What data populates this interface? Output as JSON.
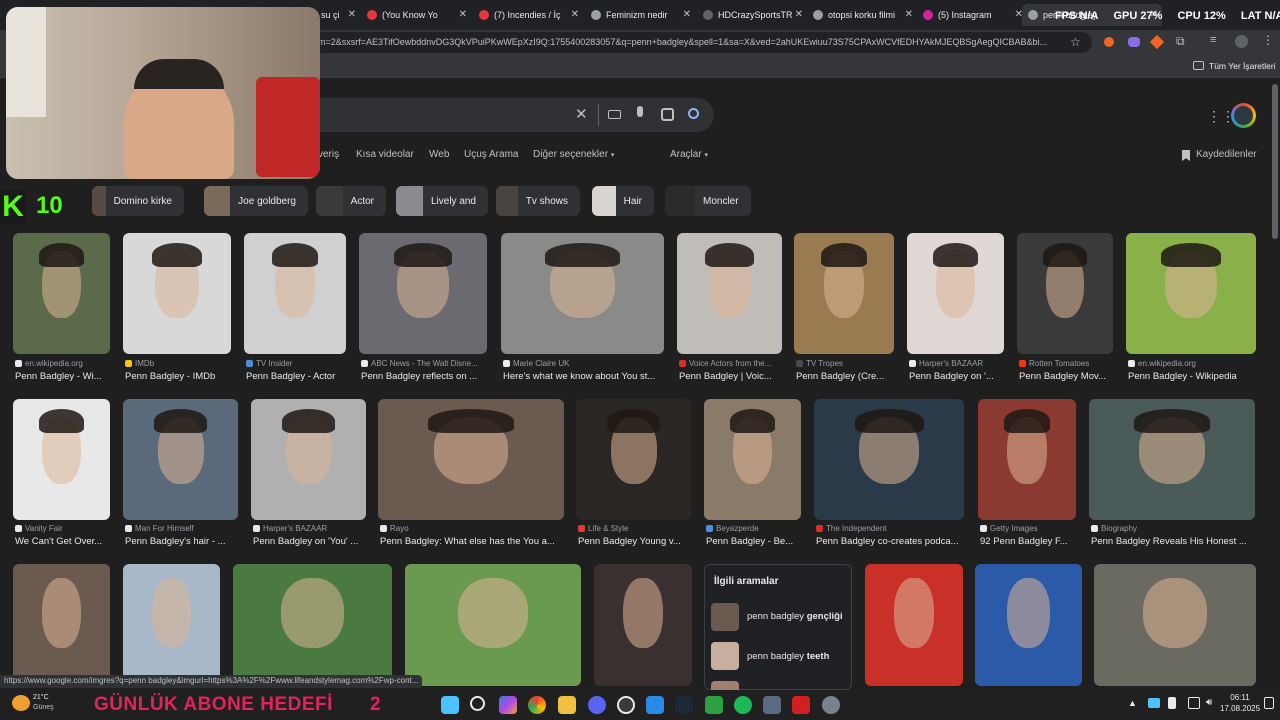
{
  "browser": {
    "tabs": [
      {
        "label": "su çi",
        "color": "#5f6368"
      },
      {
        "label": "(You Know Yo",
        "color": "#e53935"
      },
      {
        "label": "(7) Incendies / İç",
        "color": "#e53935"
      },
      {
        "label": "Feminizm nedir",
        "color": "#9aa0a6"
      },
      {
        "label": "HDCrazySportsTR",
        "color": "#5f6368"
      },
      {
        "label": "otopsi korku filmi",
        "color": "#9aa0a6"
      },
      {
        "label": "(5) Instagram",
        "color": "#d6249f"
      },
      {
        "label": "penn badgley",
        "color": "#9aa0a6"
      }
    ],
    "url": "m=2&sxsrf=AE3TifOewbddnvDG3QkVPuiPKwWEpXzI9Q:1755400283057&q=penn+badgley&spell=1&sa=X&ved=2ahUKEwiuu73S75CPAxWCVfEDHYAkMJEQBSgAegQICBAB&bi...",
    "bookmarks_label": "Tüm Yer İşaretleri"
  },
  "google": {
    "nav": {
      "tab_partial": "veriş",
      "items": [
        "Kısa videolar",
        "Web",
        "Uçuş Arama",
        "Diğer seçenekler"
      ],
      "tools": "Araçlar",
      "saved": "Kaydedilenler"
    },
    "chips": [
      {
        "label": "Domino kirke",
        "color": "#5a4a44"
      },
      {
        "label": "Joe goldberg",
        "color": "#7a6a5a"
      },
      {
        "label": "Actor",
        "color": "#3a3a3a"
      },
      {
        "label": "Lively and",
        "color": "#8a8a90"
      },
      {
        "label": "Tv shows",
        "color": "#4a4440"
      },
      {
        "label": "Hair",
        "color": "#d8d4d0"
      },
      {
        "label": "Moncler",
        "color": "#2a2a2a"
      }
    ],
    "results_row1": [
      {
        "source": "en.wikipedia.org",
        "caption": "Penn Badgley - Wi...",
        "color": "#5a6a4a",
        "icon": "#e8eaed"
      },
      {
        "source": "IMDb",
        "caption": "Penn Badgley - IMDb",
        "color": "#d8d8d8",
        "icon": "#f5c518"
      },
      {
        "source": "TV Insider",
        "caption": "Penn Badgley - Actor",
        "color": "#d0d0d0",
        "icon": "#4a90d9"
      },
      {
        "source": "ABC News - The Walt Disne...",
        "caption": "Penn Badgley reflects on ...",
        "color": "#6a6a70",
        "icon": "#e8eaed"
      },
      {
        "source": "Marie Claire UK",
        "caption": "Here's what we know about You st...",
        "color": "#8a8a88",
        "icon": "#e8eaed"
      },
      {
        "source": "Voice Actors from the...",
        "caption": "Penn Badgley | Voic...",
        "color": "#c0bcb8",
        "icon": "#d93025"
      },
      {
        "source": "TV Tropes",
        "caption": "Penn Badgley (Cre...",
        "color": "#9a7a50",
        "icon": "#4a4a4a"
      },
      {
        "source": "Harper's BAZAAR",
        "caption": "Penn Badgley on '...",
        "color": "#e0d8d4",
        "icon": "#e8eaed"
      },
      {
        "source": "Rotten Tomatoes",
        "caption": "Penn Badgley Mov...",
        "color": "#3a3a3a",
        "icon": "#fa320a"
      },
      {
        "source": "en.wikipedia.org",
        "caption": "Penn Badgley - Wikipedia",
        "color": "#8ab04a",
        "icon": "#e8eaed"
      }
    ],
    "results_row2": [
      {
        "source": "Vanity Fair",
        "caption": "We Can't Get Over...",
        "color": "#e8e8e8",
        "icon": "#e8eaed"
      },
      {
        "source": "Man For Himself",
        "caption": "Penn Badgley's hair - ...",
        "color": "#5a6a7a",
        "icon": "#e8eaed"
      },
      {
        "source": "Harper's BAZAAR",
        "caption": "Penn Badgley on 'You' ...",
        "color": "#b0b0b0",
        "icon": "#e8eaed"
      },
      {
        "source": "Rayo",
        "caption": "Penn Badgley: What else has the You a...",
        "color": "#6a5a50",
        "icon": "#e8eaed"
      },
      {
        "source": "Life & Style",
        "caption": "Penn Badgley Young v...",
        "color": "#2a2624",
        "icon": "#e53935"
      },
      {
        "source": "Beyazperde",
        "caption": "Penn Badgley - Be...",
        "color": "#8a7a68",
        "icon": "#4a90d9"
      },
      {
        "source": "The Independent",
        "caption": "Penn Badgley co-creates podca...",
        "color": "#2a3a48",
        "icon": "#d93025"
      },
      {
        "source": "Getty Images",
        "caption": "92 Penn Badgley F...",
        "color": "#8a3a30",
        "icon": "#e8eaed"
      },
      {
        "source": "Biography",
        "caption": "Penn Badgley Reveals His Honest ...",
        "color": "#4a5a58",
        "icon": "#e8eaed"
      }
    ],
    "related": {
      "title": "İlgili aramalar",
      "items": [
        {
          "prefix": "penn badgley ",
          "bold": "gençliği"
        },
        {
          "prefix": "penn badgley ",
          "bold": "teeth"
        }
      ]
    },
    "status_url": "https://www.google.com/imgres?q=penn badgley&imgurl=https%3A%2F%2Fwww.lifeandstylemag.com%2Fwp-cont..."
  },
  "overlay": {
    "stats": [
      {
        "label": "FPS",
        "value": "N/A"
      },
      {
        "label": "GPU",
        "value": "27%"
      },
      {
        "label": "CPU",
        "value": "12%"
      },
      {
        "label": "LAT",
        "value": "N/A"
      }
    ],
    "badge_letter": "K",
    "badge_number": "10"
  },
  "taskbar": {
    "weather_temp": "21°C",
    "weather_desc": "Güneş",
    "goal_label": "GÜNLÜK ABONE HEDEFİ",
    "goal_value": "2",
    "time": "06:11",
    "date": "17.08.2025"
  }
}
